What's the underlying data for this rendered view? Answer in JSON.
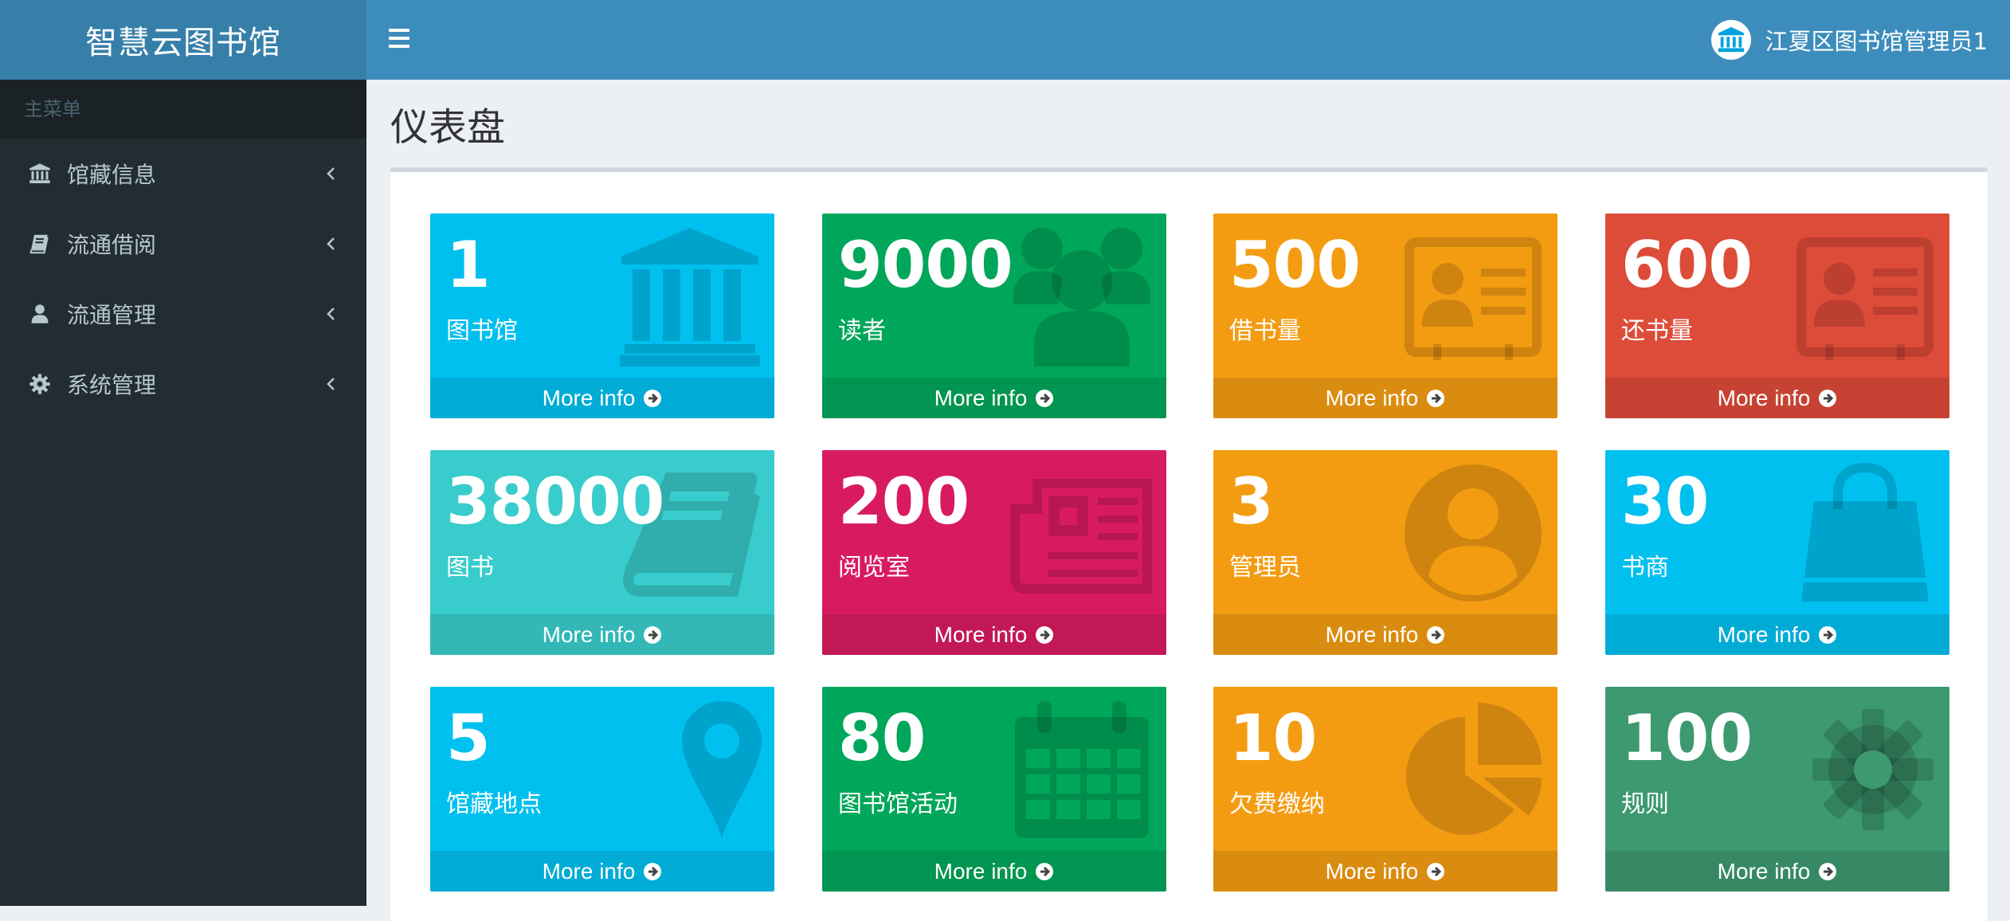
{
  "app": {
    "title": "智慧云图书馆"
  },
  "header": {
    "user": "江夏区图书馆管理员1"
  },
  "sidebar": {
    "header": "主菜单",
    "items": [
      {
        "label": "馆藏信息",
        "icon": "bank-icon"
      },
      {
        "label": "流通借阅",
        "icon": "book-icon"
      },
      {
        "label": "流通管理",
        "icon": "user-icon"
      },
      {
        "label": "系统管理",
        "icon": "gear-icon"
      }
    ]
  },
  "page": {
    "title": "仪表盘"
  },
  "more_info": "More info",
  "colors": {
    "aqua": "#00c0ef",
    "green": "#00a65a",
    "yellow": "#f39c12",
    "red": "#dd4b39",
    "teal": "#39cccc",
    "maroon": "#d81b60",
    "olive": "#3d9970"
  },
  "tiles": [
    {
      "value": "1",
      "label": "图书馆",
      "color": "#00c0ef",
      "icon": "bank-icon"
    },
    {
      "value": "9000",
      "label": "读者",
      "color": "#00a65a",
      "icon": "users-icon"
    },
    {
      "value": "500",
      "label": "借书量",
      "color": "#f39c12",
      "icon": "id-card-icon"
    },
    {
      "value": "600",
      "label": "还书量",
      "color": "#dd4b39",
      "icon": "id-card-icon"
    },
    {
      "value": "38000",
      "label": "图书",
      "color": "#39cccc",
      "icon": "book-icon"
    },
    {
      "value": "200",
      "label": "阅览室",
      "color": "#d81b60",
      "icon": "newspaper-icon"
    },
    {
      "value": "3",
      "label": "管理员",
      "color": "#f39c12",
      "icon": "user-circle-icon"
    },
    {
      "value": "30",
      "label": "书商",
      "color": "#00c0ef",
      "icon": "shopping-bag-icon"
    },
    {
      "value": "5",
      "label": "馆藏地点",
      "color": "#00c0ef",
      "icon": "map-marker-icon"
    },
    {
      "value": "80",
      "label": "图书馆活动",
      "color": "#00a65a",
      "icon": "calendar-icon"
    },
    {
      "value": "10",
      "label": "欠费缴纳",
      "color": "#f39c12",
      "icon": "pie-chart-icon"
    },
    {
      "value": "100",
      "label": "规则",
      "color": "#3d9970",
      "icon": "gear-icon"
    }
  ]
}
